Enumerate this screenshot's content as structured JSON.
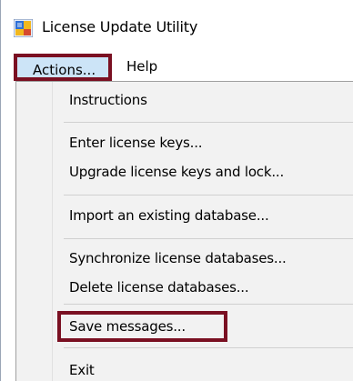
{
  "window": {
    "title": "License Update Utility"
  },
  "menu_bar": {
    "items": [
      {
        "label": "Actions..."
      },
      {
        "label": "Help"
      }
    ]
  },
  "actions_menu": {
    "items": [
      {
        "label": "Instructions"
      },
      {
        "label": "Enter license keys..."
      },
      {
        "label": "Upgrade license keys and lock..."
      },
      {
        "label": "Import an existing database..."
      },
      {
        "label": "Synchronize license databases..."
      },
      {
        "label": "Delete license databases..."
      },
      {
        "label": "Save messages..."
      },
      {
        "label": "Exit"
      }
    ]
  },
  "colors": {
    "highlight_border": "#7a1022",
    "menu_background": "#f2f2f2",
    "active_menu_background": "#cce4f7"
  },
  "icons": {
    "app_icon": "license-utility-app-icon"
  }
}
